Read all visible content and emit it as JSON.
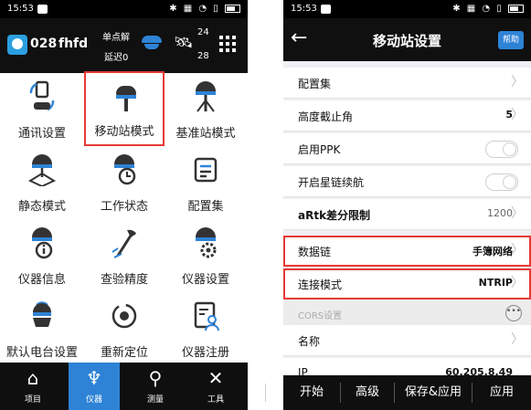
{
  "left": {
    "status": {
      "time": "15:53"
    },
    "header": {
      "base_num": "028",
      "code": "fhfd",
      "mode": "单点解",
      "delay": "延迟0",
      "sat_top": "24",
      "sat_bottom": "28"
    },
    "tiles": [
      {
        "label": "通讯设置",
        "icon": "communication-icon"
      },
      {
        "label": "移动站模式",
        "icon": "rover-receiver-icon"
      },
      {
        "label": "基准站模式",
        "icon": "base-station-icon"
      },
      {
        "label": "静态模式",
        "icon": "static-mode-icon"
      },
      {
        "label": "工作状态",
        "icon": "work-status-icon"
      },
      {
        "label": "配置集",
        "icon": "config-set-icon"
      },
      {
        "label": "仪器信息",
        "icon": "instrument-info-icon"
      },
      {
        "label": "查验精度",
        "icon": "accuracy-check-icon"
      },
      {
        "label": "仪器设置",
        "icon": "instrument-settings-icon"
      },
      {
        "label": "默认电台设置",
        "icon": "default-radio-icon"
      },
      {
        "label": "重新定位",
        "icon": "relocate-icon"
      },
      {
        "label": "仪器注册",
        "icon": "instrument-register-icon"
      }
    ],
    "nav": [
      {
        "label": "项目",
        "icon": "project-icon"
      },
      {
        "label": "仪器",
        "icon": "instrument-icon"
      },
      {
        "label": "测量",
        "icon": "survey-icon"
      },
      {
        "label": "工具",
        "icon": "tools-icon"
      }
    ]
  },
  "right": {
    "status": {
      "time": "15:53"
    },
    "header": {
      "title": "移动站设置",
      "help": "帮助"
    },
    "rows": [
      {
        "label": "配置集",
        "value": ""
      },
      {
        "label": "高度截止角",
        "value": "5"
      },
      {
        "label": "启用PPK",
        "value": ""
      },
      {
        "label": "开启星链续航",
        "value": ""
      },
      {
        "label": "aRtk差分限制",
        "value": "1200"
      },
      {
        "label": "数据链",
        "value": "手簿网络"
      },
      {
        "label": "连接模式",
        "value": "NTRIP"
      }
    ],
    "section": {
      "label": "CORS设置"
    },
    "cors_rows": [
      {
        "label": "名称",
        "value": ""
      },
      {
        "label": "IP",
        "value": "60.205.8.49"
      }
    ],
    "bottom": [
      "开始",
      "高级",
      "保存&应用",
      "应用"
    ]
  }
}
